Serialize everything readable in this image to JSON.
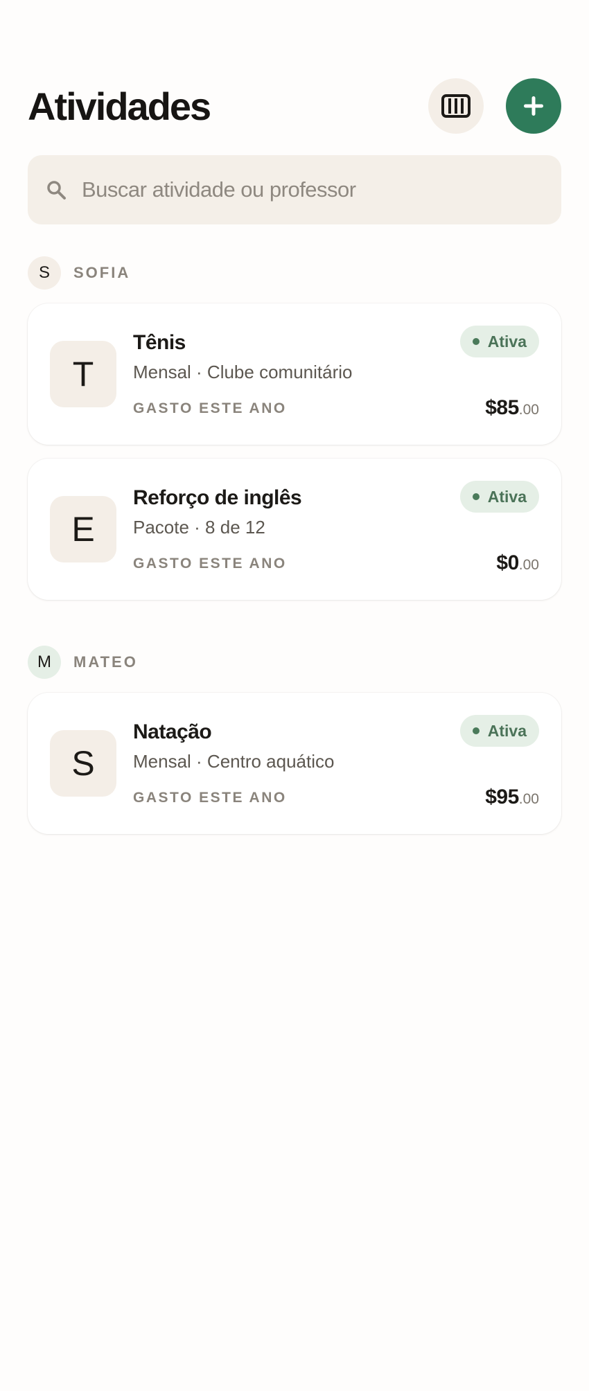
{
  "header": {
    "title": "Atividades",
    "calendar_icon": "timetable-icon",
    "add_icon": "plus-icon"
  },
  "search": {
    "placeholder": "Buscar atividade ou professor",
    "icon": "search-icon"
  },
  "groups": [
    {
      "initial": "S",
      "name": "SOFIA",
      "avatar_color": "#f4eee7",
      "activities": [
        {
          "initial": "T",
          "title": "Tênis",
          "subtitle": "Mensal · Clube comunitário",
          "status": "Ativa",
          "spent_label": "GASTO ESTE ANO",
          "amount_main": "$85",
          "amount_cents": ".00"
        },
        {
          "initial": "E",
          "title": "Reforço de inglês",
          "subtitle": "Pacote · 8 de 12",
          "status": "Ativa",
          "spent_label": "GASTO ESTE ANO",
          "amount_main": "$0",
          "amount_cents": ".00"
        }
      ]
    },
    {
      "initial": "M",
      "name": "MATEO",
      "avatar_color": "#e5efe6",
      "activities": [
        {
          "initial": "S",
          "title": "Natação",
          "subtitle": "Mensal · Centro aquático",
          "status": "Ativa",
          "spent_label": "GASTO ESTE ANO",
          "amount_main": "$95",
          "amount_cents": ".00"
        }
      ]
    }
  ],
  "colors": {
    "accent": "#2e7b5a",
    "badge_bg": "#e5efe6",
    "badge_text": "#4b7358",
    "surface": "#f4eee7"
  }
}
